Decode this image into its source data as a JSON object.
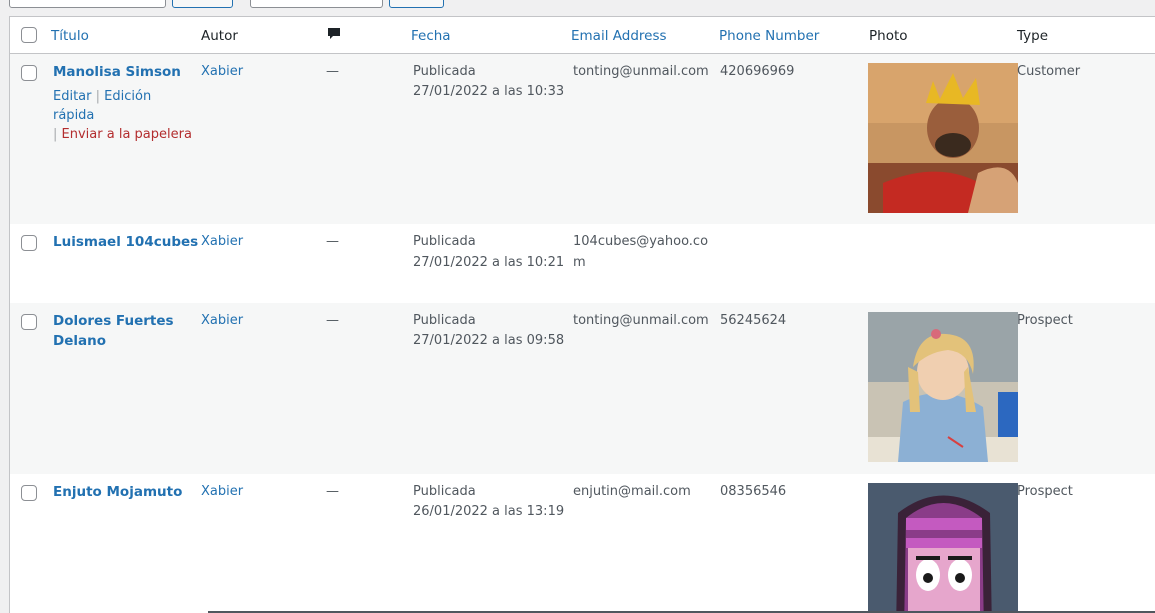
{
  "columns": {
    "titulo": "Título",
    "autor": "Autor",
    "comments_icon": "comment-bubble-icon",
    "fecha": "Fecha",
    "email": "Email Address",
    "phone": "Phone Number",
    "photo": "Photo",
    "type": "Type"
  },
  "row_actions": {
    "edit": "Editar",
    "quick_edit": "Edición rápida",
    "trash": "Enviar a la papelera",
    "sep": "|"
  },
  "rows": [
    {
      "title": "Manolisa Simson",
      "author": "Xabier",
      "comments": "—",
      "status": "Publicada",
      "date": "27/01/2022 a las 10:33",
      "email": "tonting@unmail.com",
      "phone": "420696969",
      "type": "Customer"
    },
    {
      "title": "Luismael 104cubes",
      "author": "Xabier",
      "comments": "—",
      "status": "Publicada",
      "date": "27/01/2022 a las 10:21",
      "email_line1": "104cubes@yahoo.co",
      "email_line2": "m",
      "phone": "",
      "type": ""
    },
    {
      "title_line1": "Dolores Fuertes",
      "title_line2": "Delano",
      "author": "Xabier",
      "comments": "—",
      "status": "Publicada",
      "date": "27/01/2022 a las 09:58",
      "email": "tonting@unmail.com",
      "phone": "56245624",
      "type": "Prospect"
    },
    {
      "title": "Enjuto Mojamuto",
      "author": "Xabier",
      "comments": "—",
      "status": "Publicada",
      "date": "26/01/2022 a las 13:19",
      "email": "enjutin@mail.com",
      "phone": "08356546",
      "type": "Prospect"
    }
  ],
  "colors": {
    "link": "#2271b1",
    "trash": "#b32d2e",
    "alt_row": "#f6f7f7",
    "border": "#c3c4c7"
  }
}
